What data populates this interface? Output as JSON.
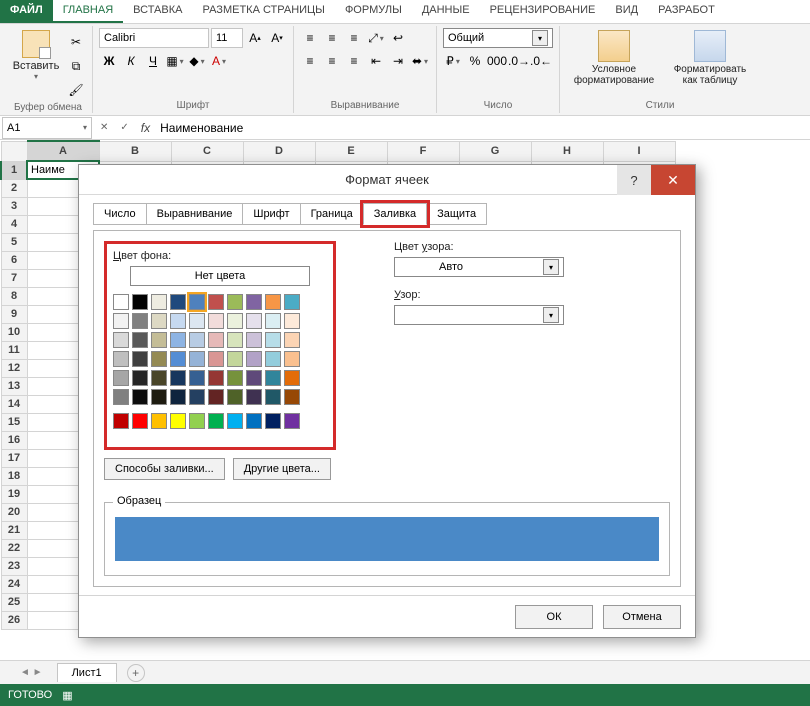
{
  "ribbonTabs": {
    "file": "ФАЙЛ",
    "home": "ГЛАВНАЯ",
    "insert": "ВСТАВКА",
    "pageLayout": "РАЗМЕТКА СТРАНИЦЫ",
    "formulas": "ФОРМУЛЫ",
    "data": "ДАННЫЕ",
    "review": "РЕЦЕНЗИРОВАНИЕ",
    "view": "ВИД",
    "dev": "РАЗРАБОТ"
  },
  "ribbon": {
    "paste": "Вставить",
    "clipboardGroup": "Буфер обмена",
    "fontName": "Calibri",
    "fontSize": "11",
    "fontGroup": "Шрифт",
    "alignGroup": "Выравнивание",
    "numberFormat": "Общий",
    "numberGroup": "Число",
    "condFormat": "Условное форматирование",
    "formatTable": "Форматировать как таблицу",
    "stylesGroup": "Стили"
  },
  "nameBox": "A1",
  "formulaValue": "Наименование",
  "columns": [
    "A",
    "B",
    "C",
    "D",
    "E",
    "F",
    "G",
    "H",
    "I"
  ],
  "rowCount": 26,
  "cellA1": "Наиме",
  "sheetTab": "Лист1",
  "status": "ГОТОВО",
  "dialog": {
    "title": "Формат ячеек",
    "tabs": {
      "number": "Число",
      "alignment": "Выравнивание",
      "font": "Шрифт",
      "border": "Граница",
      "fill": "Заливка",
      "protection": "Защита"
    },
    "bgColorLabel": "Цвет фона:",
    "noColor": "Нет цвета",
    "fillEffects": "Способы заливки...",
    "moreColors": "Другие цвета...",
    "patternColorLabel": "Цвет узора:",
    "patternColorValue": "Авто",
    "patternLabel": "Узор:",
    "sampleLabel": "Образец",
    "ok": "ОК",
    "cancel": "Отмена",
    "themeColors": [
      "#ffffff",
      "#000000",
      "#eeece1",
      "#1f497d",
      "#4f81bd",
      "#c0504d",
      "#9bbb59",
      "#8064a2",
      "#f79646",
      "#4bacc6",
      "#f2f2f2",
      "#808080",
      "#ddd9c4",
      "#c6d9f0",
      "#dce6f1",
      "#f2dcdb",
      "#ebf1dd",
      "#e5e0ec",
      "#dbeef3",
      "#fdeada",
      "#d9d9d9",
      "#595959",
      "#c4bd97",
      "#8eb4e3",
      "#b8cce4",
      "#e6b9b8",
      "#d7e4bc",
      "#ccc1d9",
      "#b7dde8",
      "#fbd4b4",
      "#bfbfbf",
      "#404040",
      "#948a54",
      "#548dd4",
      "#95b3d7",
      "#d99694",
      "#c3d69b",
      "#b2a2c7",
      "#93cddc",
      "#fac08f",
      "#a6a6a6",
      "#262626",
      "#494529",
      "#17365d",
      "#366092",
      "#953734",
      "#76923c",
      "#5f497a",
      "#31859b",
      "#e36c09",
      "#808080",
      "#0d0d0d",
      "#1d1b10",
      "#0f243e",
      "#244061",
      "#632423",
      "#4f6228",
      "#3f3151",
      "#205867",
      "#974806"
    ],
    "standardColors": [
      "#c00000",
      "#ff0000",
      "#ffc000",
      "#ffff00",
      "#92d050",
      "#00b050",
      "#00b0f0",
      "#0070c0",
      "#002060",
      "#7030a0"
    ]
  }
}
